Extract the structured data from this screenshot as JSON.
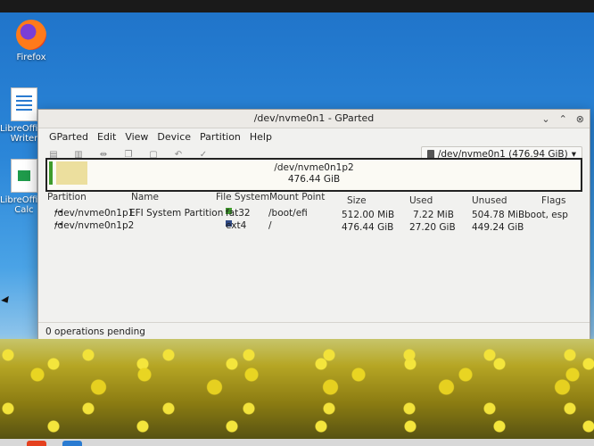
{
  "desktop": {
    "icons": [
      {
        "label": "Firefox",
        "icon": "firefox-icon"
      },
      {
        "label": "LibreOffice Writer",
        "icon": "writer-icon"
      },
      {
        "label": "LibreOffice Calc",
        "icon": "calc-icon"
      }
    ]
  },
  "window": {
    "title": "/dev/nvme0n1 - GParted",
    "controls": {
      "minimize": "⌄",
      "maximize": "⌃",
      "close": "⊗"
    }
  },
  "menu": [
    "GParted",
    "Edit",
    "View",
    "Device",
    "Partition",
    "Help"
  ],
  "toolbar": {
    "buttons": [
      "new-icon",
      "delete-icon",
      "resize-icon",
      "copy-icon",
      "paste-icon",
      "undo-icon",
      "apply-icon"
    ],
    "device_selector": "/dev/nvme0n1 (476.94 GiB)"
  },
  "partition_bar": {
    "name": "/dev/nvme0n1p2",
    "size": "476.44 GiB",
    "used_fraction": 0.06
  },
  "table": {
    "headers": {
      "partition": "Partition",
      "name": "Name",
      "filesystem": "File System",
      "mount": "Mount Point",
      "size": "Size",
      "used": "Used",
      "unused": "Unused",
      "flags": "Flags"
    },
    "rows": [
      {
        "partition": "/dev/nvme0n1p1",
        "name": "EFI System Partition",
        "filesystem": "fat32",
        "fs_color": "#3f9b2c",
        "mount": "/boot/efi",
        "size": "512.00 MiB",
        "used": "7.22 MiB",
        "unused": "504.78 MiB",
        "flags": "boot, esp"
      },
      {
        "partition": "/dev/nvme0n1p2",
        "name": "",
        "filesystem": "ext4",
        "fs_color": "#2f4a86",
        "mount": "/",
        "size": "476.44 GiB",
        "used": "27.20 GiB",
        "unused": "449.24 GiB",
        "flags": ""
      }
    ]
  },
  "status": "0 operations pending"
}
